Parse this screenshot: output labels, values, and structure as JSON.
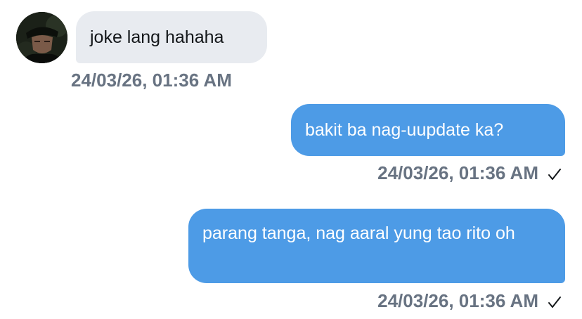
{
  "messages": [
    {
      "direction": "incoming",
      "text": "joke lang hahaha",
      "timestamp": "24/03/26, 01:36 AM",
      "avatar": "user-avatar-photo"
    },
    {
      "direction": "outgoing",
      "text": "bakit ba nag-uupdate ka?",
      "timestamp": "24/03/26, 01:36 AM",
      "status_icon": "checkmark-icon"
    },
    {
      "direction": "outgoing",
      "text": "parang tanga, nag aaral yung tao rito oh",
      "timestamp": "24/03/26, 01:36 AM",
      "status_icon": "checkmark-icon"
    }
  ],
  "colors": {
    "incoming_bubble": "#e8ebf0",
    "outgoing_bubble": "#4d9be6",
    "timestamp_text": "#687382",
    "background": "#ffffff"
  }
}
